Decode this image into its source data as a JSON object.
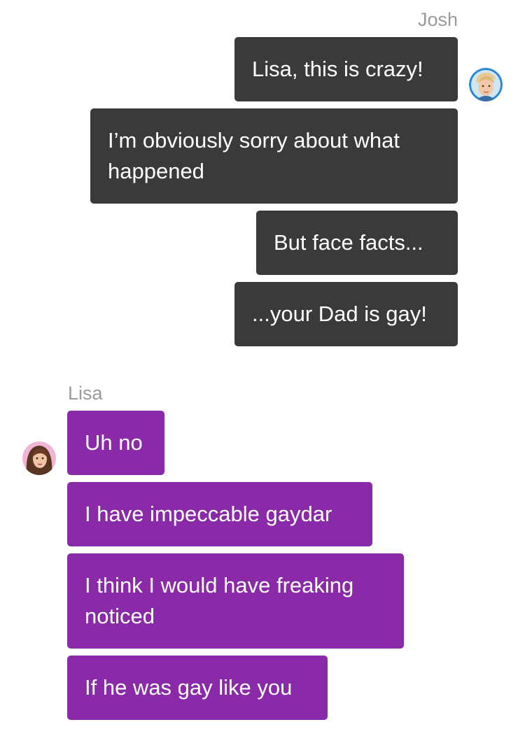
{
  "conversation": {
    "josh": {
      "name": "Josh",
      "bubble_color": "#3a3a3a",
      "messages": [
        "Lisa, this is crazy!",
        "I’m obviously sorry about what happened",
        "But face facts...",
        "...your Dad is gay!"
      ]
    },
    "lisa": {
      "name": "Lisa",
      "bubble_color": "#8a2aa8",
      "messages": [
        "Uh no",
        "I have impeccable gaydar",
        "I think I would have freaking noticed",
        "If he was gay like you"
      ]
    }
  }
}
